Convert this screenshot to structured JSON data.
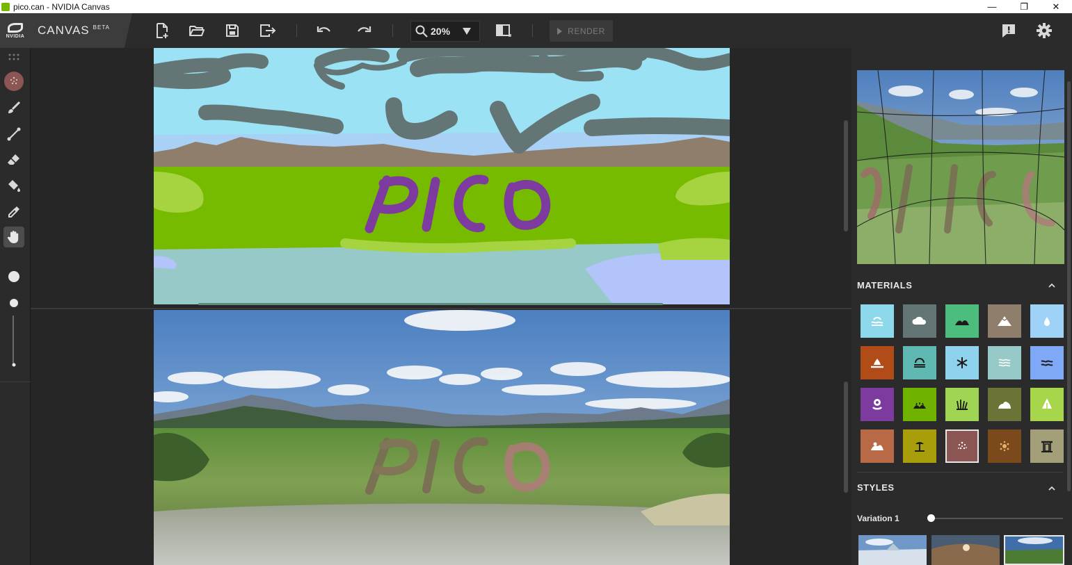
{
  "window": {
    "title": "pico.can - NVIDIA Canvas",
    "minimize_glyph": "—",
    "restore_glyph": "❐",
    "close_glyph": "✕"
  },
  "brand": {
    "logo_text": "NVIDIA",
    "app_name": "CANVAS",
    "badge": "BETA"
  },
  "toolbar": {
    "zoom_value": "20%",
    "render_label": "RENDER"
  },
  "segmentation_map": {
    "drawn_text": "PICO"
  },
  "panels": {
    "materials_title": "MATERIALS",
    "styles_title": "STYLES",
    "variation_label": "Variation 1",
    "variation_value": 0.0
  },
  "materials": [
    {
      "icon": "sea-icon",
      "color": "#8ed8ec"
    },
    {
      "icon": "cloud-icon",
      "color": "#637574"
    },
    {
      "icon": "hill-icon",
      "color": "#4cbd7d"
    },
    {
      "icon": "mountain-icon",
      "color": "#8f7e6b"
    },
    {
      "icon": "water-drop-icon",
      "color": "#9fd2f7"
    },
    {
      "icon": "dirt-icon",
      "color": "#b14b17"
    },
    {
      "icon": "fog-icon",
      "color": "#5fb8b2"
    },
    {
      "icon": "snow-icon",
      "color": "#8fd2ee"
    },
    {
      "icon": "river-icon",
      "color": "#96c9c7"
    },
    {
      "icon": "lake-icon",
      "color": "#7fa8f7"
    },
    {
      "icon": "flower-icon",
      "color": "#7d3a9f"
    },
    {
      "icon": "grass-icon",
      "color": "#6fb200"
    },
    {
      "icon": "tall-grass-icon",
      "color": "#9fd552"
    },
    {
      "icon": "rock-icon",
      "color": "#6c7337"
    },
    {
      "icon": "tree-icon",
      "color": "#a7d64a"
    },
    {
      "icon": "sand-icon",
      "color": "#b76a45"
    },
    {
      "icon": "beach-icon",
      "color": "#a89d0b"
    },
    {
      "icon": "blossom-icon",
      "color": "#8c5654",
      "selected": true
    },
    {
      "icon": "bush-icon",
      "color": "#7a4a1d"
    },
    {
      "icon": "building-icon",
      "color": "#a39f78"
    }
  ]
}
